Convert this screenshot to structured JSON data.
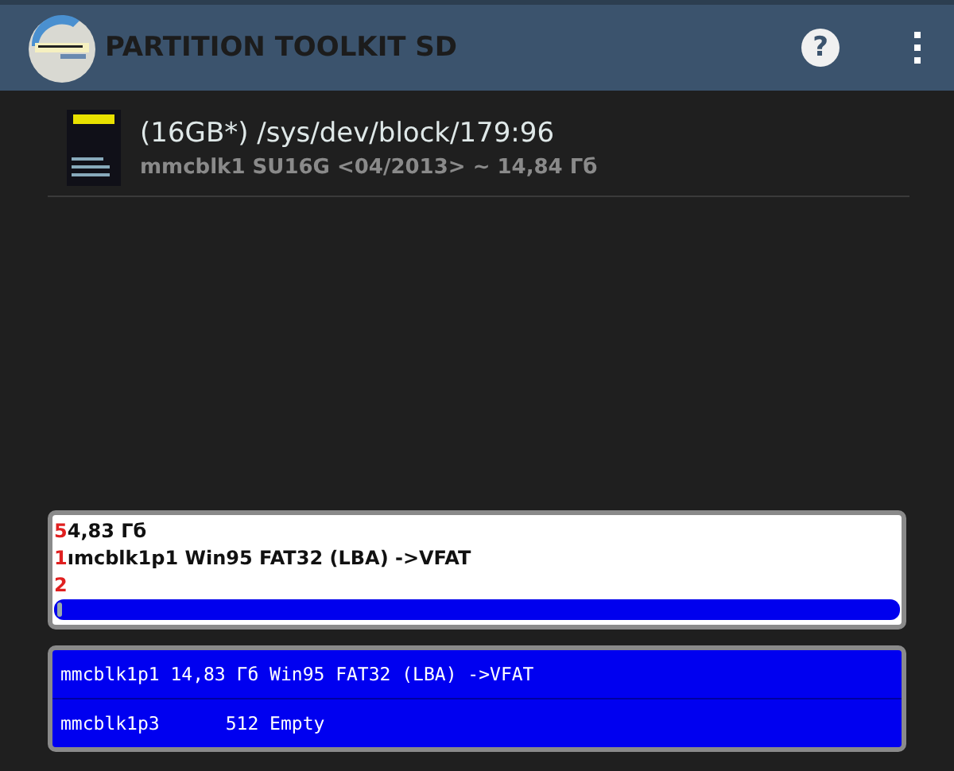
{
  "app_bar": {
    "title": "PARTITION TOOLKIT SD",
    "help": "?"
  },
  "device": {
    "title": "(16GB*) /sys/dev/block/179:96",
    "subtitle": "mmcblk1 SU16G <04/2013>  ~ 14,84 Гб"
  },
  "partition_map": {
    "lines": [
      {
        "marker": "5",
        "text": "4,83 Гб"
      },
      {
        "marker": "1",
        "text": "ımcblk1p1 Win95 FAT32 (LBA) ->VFAT"
      },
      {
        "marker": "2"
      }
    ]
  },
  "partitions": [
    {
      "text": "mmcblk1p1 14,83 Гб Win95 FAT32 (LBA) ->VFAT"
    },
    {
      "text": "mmcblk1p3      512 Empty"
    }
  ]
}
